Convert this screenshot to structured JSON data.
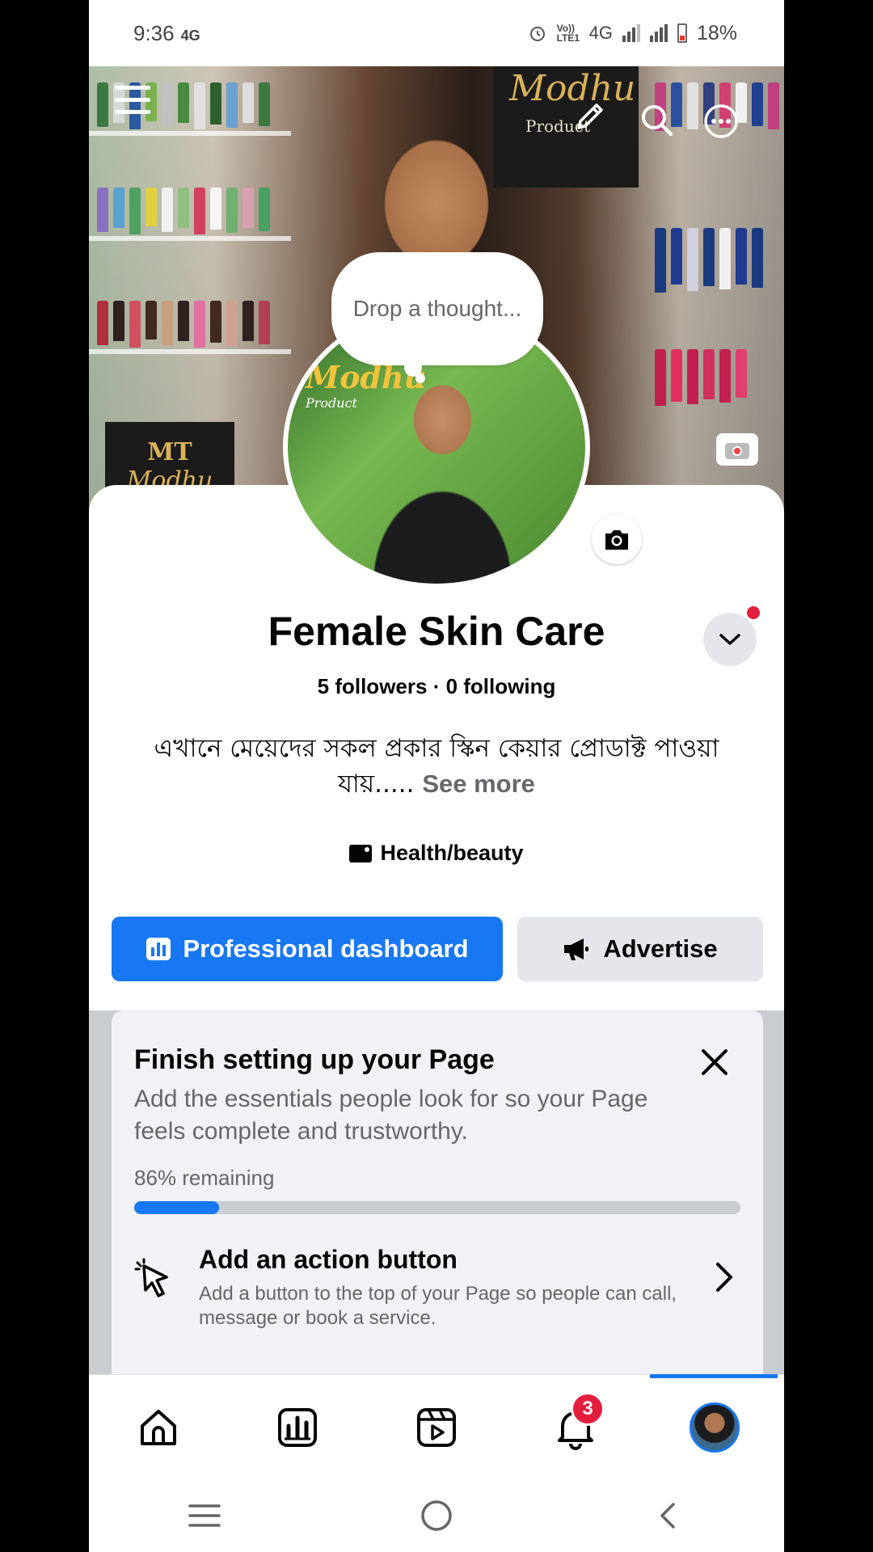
{
  "status_bar": {
    "time": "9:36",
    "network_small": "4G",
    "volte": "Vo)) LTE1",
    "network": "4G",
    "battery": "18%"
  },
  "cover": {
    "sign_line1": "Modhu",
    "sign_line2": "Product",
    "logo_line1": "MT",
    "logo_line2": "Modhu"
  },
  "profile": {
    "avatar_line1": "Modhu",
    "avatar_line2": "Product",
    "thought_placeholder": "Drop a thought...",
    "page_name": "Female Skin Care",
    "followers": "5 followers",
    "separator": " · ",
    "following": "0 following",
    "bio": "এখানে মেয়েদের সকল প্রকার স্কিন কেয়ার প্রোডাক্ট পাওয়া যায়.....",
    "see_more": "See more",
    "category": "Health/beauty"
  },
  "actions": {
    "pro_dashboard": "Professional dashboard",
    "advertise": "Advertise"
  },
  "setup": {
    "title": "Finish setting up your Page",
    "description": "Add the essentials people look for so your Page feels complete and trustworthy.",
    "progress_label": "86% remaining",
    "progress_fraction": 0.14,
    "action_title": "Add an action button",
    "action_description": "Add a button to the top of your Page so people can call, message or book a service."
  },
  "bottom_nav": {
    "notification_count": "3"
  },
  "colors": {
    "accent": "#1877f2",
    "badge": "#e41e3f"
  }
}
